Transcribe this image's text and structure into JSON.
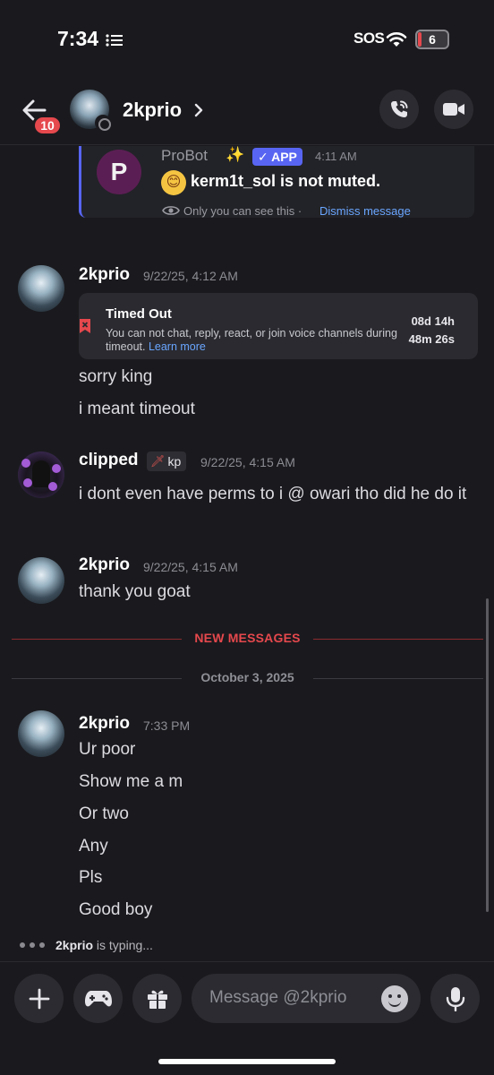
{
  "status_bar": {
    "time": "7:34",
    "sos": "SOS",
    "battery": "6",
    "time_icon": "focus-list-icon"
  },
  "header": {
    "back_badge": "10",
    "title": "2kprio",
    "call_icon": "phone-call-icon",
    "video_icon": "video-camera-icon"
  },
  "probot": {
    "avatar_letter": "P",
    "name": "ProBot",
    "sparkle": "✨",
    "badge": "✓ APP",
    "time": "4:11 AM",
    "emoji": "😊",
    "message": "kerm1t_sol is not muted.",
    "ephemeral_note": "Only you can see this ·",
    "dismiss": "Dismiss message"
  },
  "messages": [
    {
      "author": "2kprio",
      "time": "9/22/25, 4:12 AM",
      "timeout_card": {
        "title": "Timed Out",
        "description": "You can not chat, reply, react, or join voice channels during timeout.",
        "learn_more": "Learn more",
        "remaining_1": "08d 14h",
        "remaining_2": "48m 26s"
      },
      "lines": [
        "sorry king",
        "i meant timeout"
      ]
    },
    {
      "author": "clipped",
      "role": "kp",
      "role_icon": "🗡",
      "time": "9/22/25, 4:15 AM",
      "lines": [
        "i dont even have perms to i @ owari tho did he do it"
      ]
    },
    {
      "author": "2kprio",
      "time": "9/22/25, 4:15 AM",
      "lines": [
        "thank you goat"
      ]
    },
    {
      "author": "2kprio",
      "time": "7:33 PM",
      "lines": [
        "Ur poor",
        "Show me a m",
        "Or two",
        "Any",
        "Pls",
        "Good boy"
      ]
    }
  ],
  "dividers": {
    "new_messages": "NEW MESSAGES",
    "date": "October 3, 2025"
  },
  "typing": {
    "name": "2kprio",
    "text": " is typing..."
  },
  "composer": {
    "placeholder": "Message @2kprio",
    "buttons": [
      "plus-icon",
      "gamepad-icon",
      "gift-icon",
      "emoji-icon",
      "microphone-icon"
    ]
  },
  "colors": {
    "background": "#1a1a1e",
    "accent": "#5865f2",
    "danger": "#e5484d",
    "link": "#6aa6ff"
  }
}
